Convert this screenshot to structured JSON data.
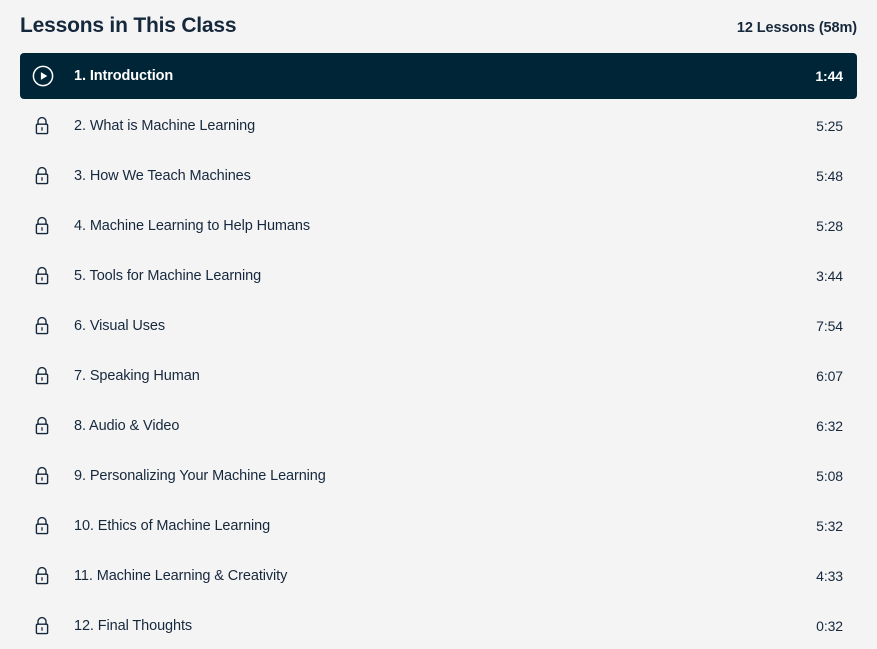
{
  "header": {
    "title": "Lessons in This Class",
    "meta": "12 Lessons (58m)"
  },
  "colors": {
    "page_background": "#f4f4f5",
    "active_row_background": "#002537",
    "text": "#16283c",
    "active_text": "#ffffff"
  },
  "lessons": [
    {
      "label": "1. Introduction",
      "duration": "1:44",
      "icon": "play-icon",
      "state": "active"
    },
    {
      "label": "2. What is Machine Learning",
      "duration": "5:25",
      "icon": "lock-icon",
      "state": "locked"
    },
    {
      "label": "3. How We Teach Machines",
      "duration": "5:48",
      "icon": "lock-icon",
      "state": "locked"
    },
    {
      "label": "4. Machine Learning to Help Humans",
      "duration": "5:28",
      "icon": "lock-icon",
      "state": "locked"
    },
    {
      "label": "5. Tools for Machine Learning",
      "duration": "3:44",
      "icon": "lock-icon",
      "state": "locked"
    },
    {
      "label": "6. Visual Uses",
      "duration": "7:54",
      "icon": "lock-icon",
      "state": "locked"
    },
    {
      "label": "7. Speaking Human",
      "duration": "6:07",
      "icon": "lock-icon",
      "state": "locked"
    },
    {
      "label": "8. Audio & Video",
      "duration": "6:32",
      "icon": "lock-icon",
      "state": "locked"
    },
    {
      "label": "9. Personalizing Your Machine Learning",
      "duration": "5:08",
      "icon": "lock-icon",
      "state": "locked"
    },
    {
      "label": "10. Ethics of Machine Learning",
      "duration": "5:32",
      "icon": "lock-icon",
      "state": "locked"
    },
    {
      "label": "11. Machine Learning & Creativity",
      "duration": "4:33",
      "icon": "lock-icon",
      "state": "locked"
    },
    {
      "label": "12. Final Thoughts",
      "duration": "0:32",
      "icon": "lock-icon",
      "state": "locked"
    }
  ]
}
